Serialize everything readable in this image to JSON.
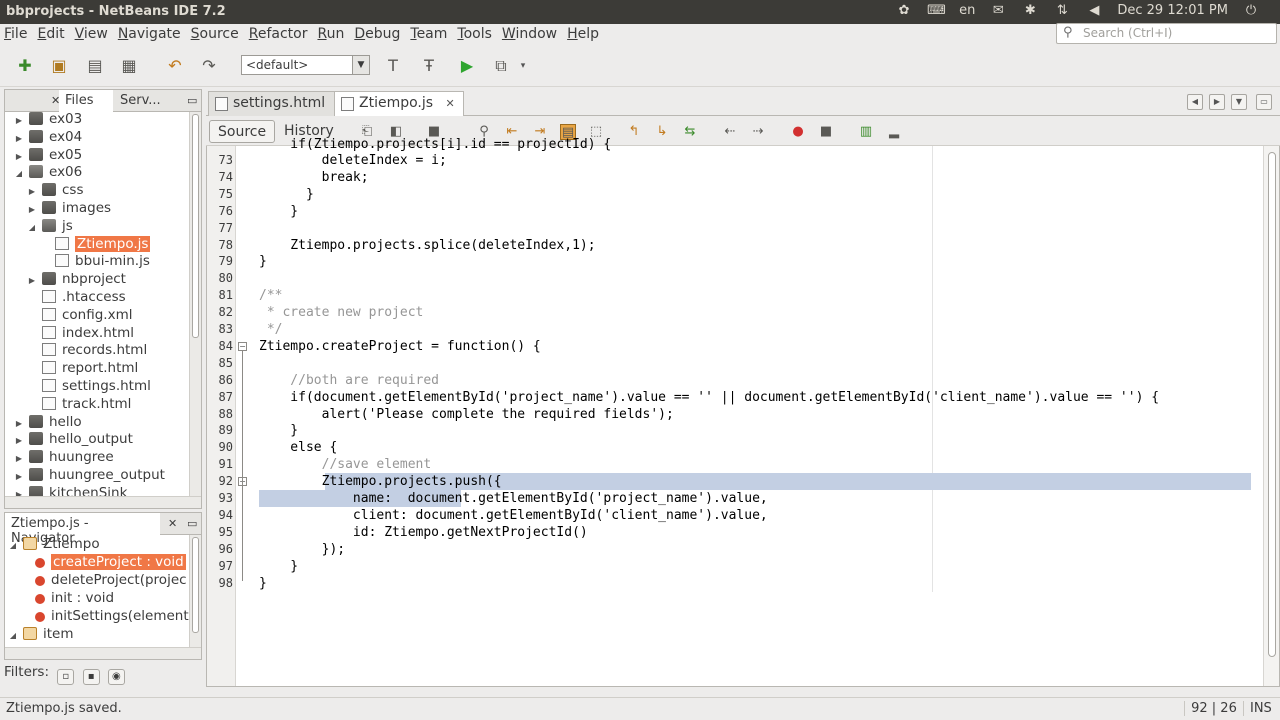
{
  "window": {
    "title": "bbprojects - NetBeans IDE 7.2",
    "tray_lang": "en",
    "tray_datetime": "Dec 29  12:01 PM"
  },
  "menu": [
    "File",
    "Edit",
    "View",
    "Navigate",
    "Source",
    "Refactor",
    "Run",
    "Debug",
    "Team",
    "Tools",
    "Window",
    "Help"
  ],
  "search": {
    "placeholder": "Search (Ctrl+I)"
  },
  "toolbar": {
    "config_value": "<default>"
  },
  "projects_panel": {
    "tabs": [
      "Files",
      "Serv..."
    ],
    "tree": [
      {
        "label": "ex03",
        "level": 1,
        "type": "folder",
        "expanded": false
      },
      {
        "label": "ex04",
        "level": 1,
        "type": "folder",
        "expanded": false
      },
      {
        "label": "ex05",
        "level": 1,
        "type": "folder",
        "expanded": false
      },
      {
        "label": "ex06",
        "level": 1,
        "type": "folder",
        "expanded": true
      },
      {
        "label": "css",
        "level": 2,
        "type": "folder",
        "expanded": false
      },
      {
        "label": "images",
        "level": 2,
        "type": "folder",
        "expanded": false
      },
      {
        "label": "js",
        "level": 2,
        "type": "folder",
        "expanded": true
      },
      {
        "label": "Ztiempo.js",
        "level": 3,
        "type": "file",
        "selected": true
      },
      {
        "label": "bbui-min.js",
        "level": 3,
        "type": "file"
      },
      {
        "label": "nbproject",
        "level": 2,
        "type": "folder",
        "expanded": false
      },
      {
        "label": ".htaccess",
        "level": 2,
        "type": "file"
      },
      {
        "label": "config.xml",
        "level": 2,
        "type": "file"
      },
      {
        "label": "index.html",
        "level": 2,
        "type": "file"
      },
      {
        "label": "records.html",
        "level": 2,
        "type": "file"
      },
      {
        "label": "report.html",
        "level": 2,
        "type": "file"
      },
      {
        "label": "settings.html",
        "level": 2,
        "type": "file"
      },
      {
        "label": "track.html",
        "level": 2,
        "type": "file"
      },
      {
        "label": "hello",
        "level": 1,
        "type": "folder",
        "expanded": false
      },
      {
        "label": "hello_output",
        "level": 1,
        "type": "folder",
        "expanded": false
      },
      {
        "label": "huungree",
        "level": 1,
        "type": "folder",
        "expanded": false
      },
      {
        "label": "huungree_output",
        "level": 1,
        "type": "folder",
        "expanded": false
      },
      {
        "label": "kitchenSink",
        "level": 1,
        "type": "folder",
        "expanded": false
      }
    ]
  },
  "navigator": {
    "title": "Ztiempo.js - Navigator",
    "tree": [
      {
        "label": "Ztiempo",
        "level": 0,
        "type": "object",
        "expanded": true
      },
      {
        "label": "createProject : void",
        "level": 1,
        "type": "method",
        "selected": true
      },
      {
        "label": "deleteProject(projec",
        "level": 1,
        "type": "method"
      },
      {
        "label": "init : void",
        "level": 1,
        "type": "method"
      },
      {
        "label": "initSettings(element",
        "level": 1,
        "type": "method"
      },
      {
        "label": "item",
        "level": 0,
        "type": "object",
        "expanded": true
      }
    ],
    "filters_label": "Filters:"
  },
  "editor": {
    "tabs": [
      {
        "label": "settings.html",
        "active": false
      },
      {
        "label": "Ztiempo.js",
        "active": true
      }
    ],
    "source_label": "Source",
    "history_label": "History",
    "lines": [
      {
        "n": "73",
        "text": "        deleteIndex = i;"
      },
      {
        "n": "74",
        "text": "        break;"
      },
      {
        "n": "75",
        "text": "      }"
      },
      {
        "n": "76",
        "text": "    }"
      },
      {
        "n": "77",
        "text": ""
      },
      {
        "n": "78",
        "text": "    Ztiempo.projects.splice(deleteIndex,1);"
      },
      {
        "n": "79",
        "text": "}"
      },
      {
        "n": "80",
        "text": ""
      },
      {
        "n": "81",
        "text": "/**"
      },
      {
        "n": "82",
        "text": " * create new project"
      },
      {
        "n": "83",
        "text": " */"
      },
      {
        "n": "84",
        "text": "Ztiempo.createProject = function() {"
      },
      {
        "n": "85",
        "text": ""
      },
      {
        "n": "86",
        "text": "    //both are required"
      },
      {
        "n": "87",
        "text": "    if(document.getElementById('project_name').value == '' || document.getElementById('client_name').value == '') {"
      },
      {
        "n": "88",
        "text": "        alert('Please complete the required fields');"
      },
      {
        "n": "89",
        "text": "    }"
      },
      {
        "n": "90",
        "text": "    else {"
      },
      {
        "n": "91",
        "text": "        //save element"
      },
      {
        "n": "92",
        "text": "        Ztiempo.projects.push({"
      },
      {
        "n": "93",
        "text": "            name:  document.getElementById('project_name').value,"
      },
      {
        "n": "94",
        "text": "            client: document.getElementById('client_name').value,"
      },
      {
        "n": "95",
        "text": "            id: Ztiempo.getNextProjectId()"
      },
      {
        "n": "96",
        "text": "        });"
      },
      {
        "n": "97",
        "text": "    }"
      },
      {
        "n": "98",
        "text": "}"
      }
    ],
    "partial_top_line": "    if(Ztiempo.projects[i].id == projectId) {"
  },
  "status": {
    "message": "Ztiempo.js saved.",
    "position": "92 | 26",
    "mode": "INS"
  }
}
